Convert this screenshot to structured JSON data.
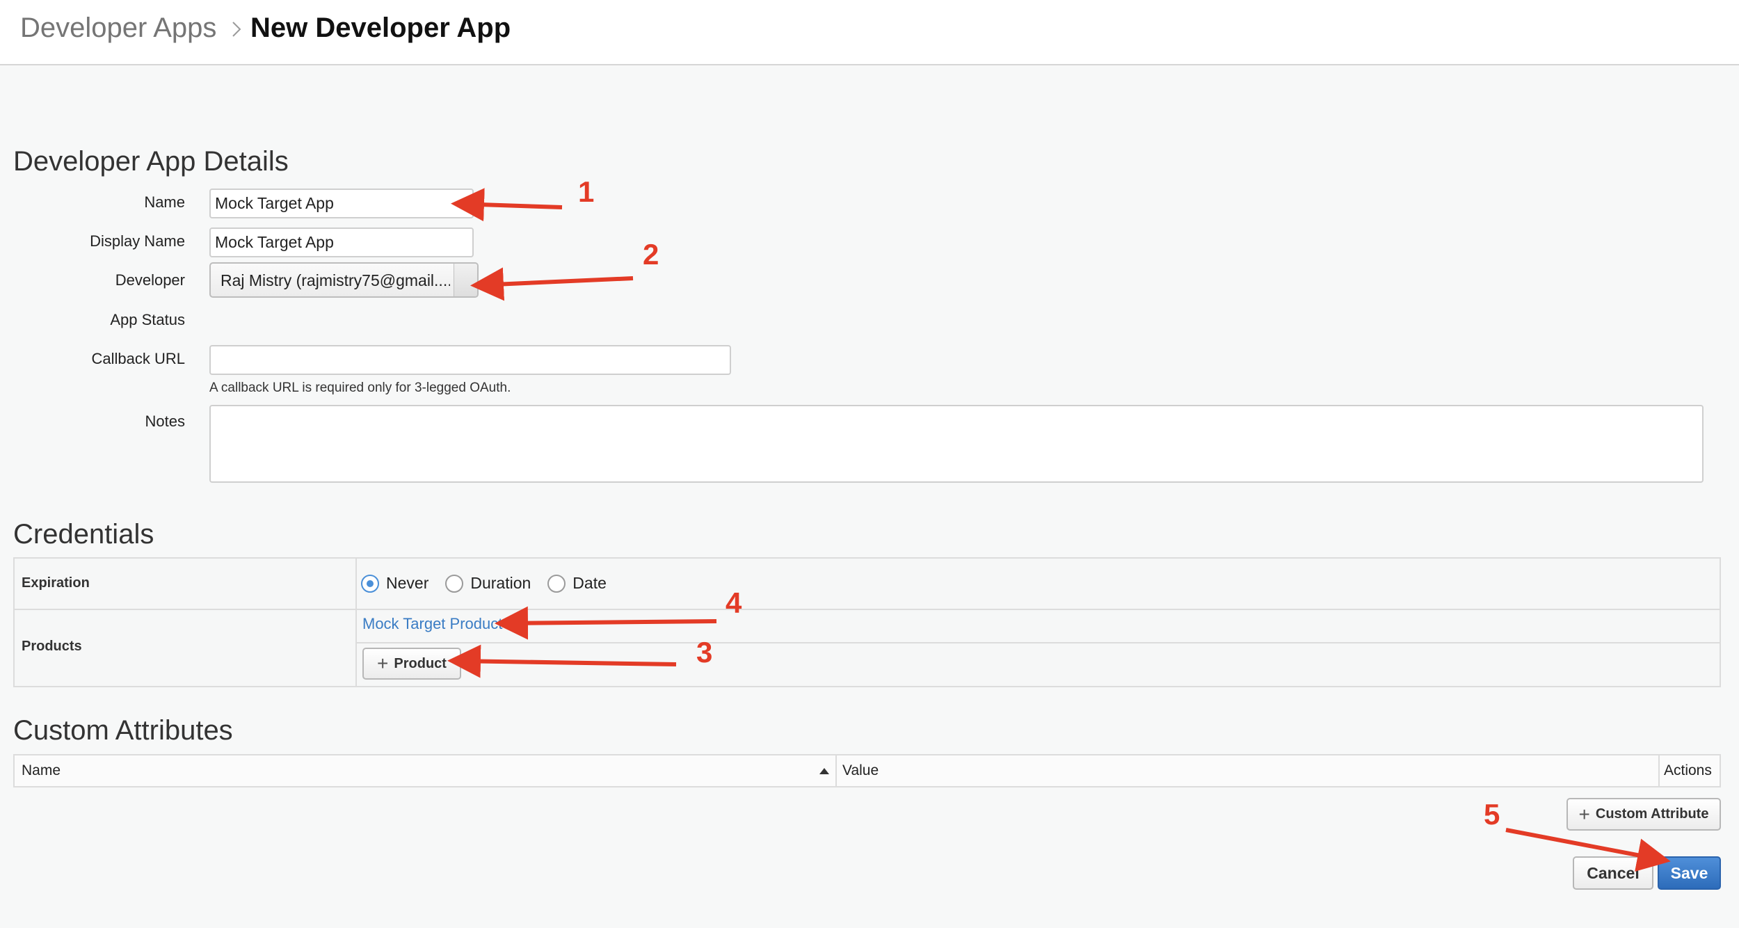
{
  "breadcrumb": {
    "parent": "Developer Apps",
    "current": "New Developer App"
  },
  "details": {
    "title": "Developer App Details",
    "name_label": "Name",
    "name_value": "Mock Target App",
    "display_name_label": "Display Name",
    "display_name_value": "Mock Target App",
    "developer_label": "Developer",
    "developer_value": "Raj Mistry (rajmistry75@gmail....",
    "app_status_label": "App Status",
    "callback_label": "Callback URL",
    "callback_value": "",
    "callback_hint": "A callback URL is required only for 3-legged OAuth.",
    "notes_label": "Notes",
    "notes_value": ""
  },
  "credentials": {
    "title": "Credentials",
    "expiration_label": "Expiration",
    "expiration_options": [
      "Never",
      "Duration",
      "Date"
    ],
    "expiration_selected": "Never",
    "products_label": "Products",
    "product_link": "Mock Target Product",
    "add_product_label": "Product"
  },
  "custom_attributes": {
    "title": "Custom Attributes",
    "columns": [
      "Name",
      "Value",
      "Actions"
    ],
    "add_label": "Custom Attribute"
  },
  "actions": {
    "cancel_label": "Cancel",
    "save_label": "Save"
  },
  "annotations": [
    "1",
    "2",
    "3",
    "4",
    "5"
  ],
  "colors": {
    "accent": "#3a7cc4",
    "primary_button": "#2d6cba",
    "annotation_arrow": "#e33b26"
  }
}
